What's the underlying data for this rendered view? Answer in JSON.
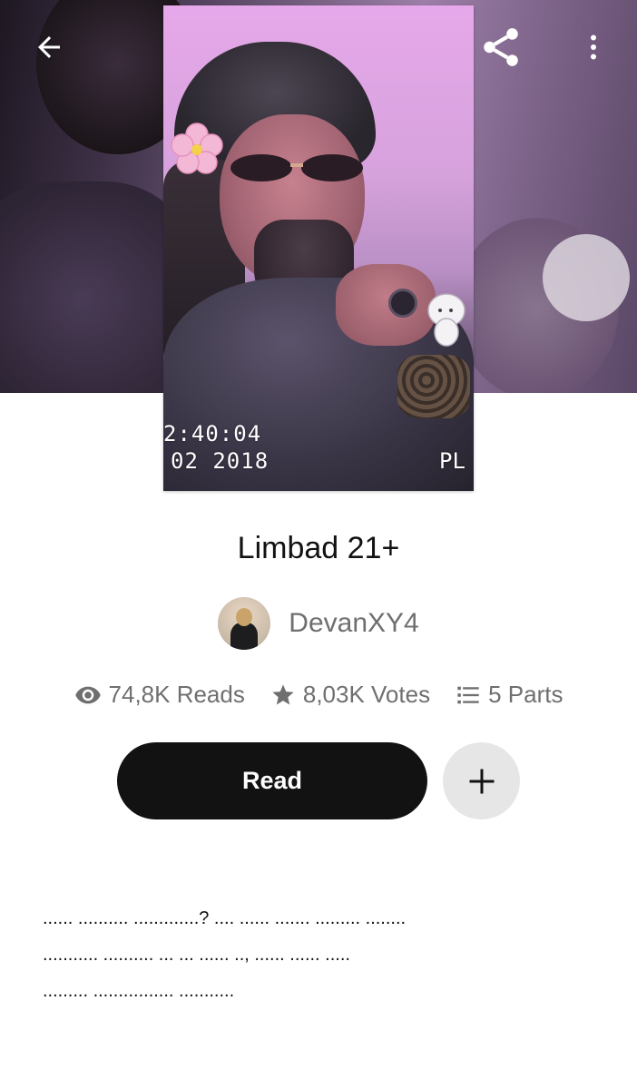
{
  "header": {
    "back_icon": "arrow-left-icon",
    "share_icon": "share-icon",
    "more_icon": "more-vertical-icon"
  },
  "cover": {
    "time_overlay": "2:40:04",
    "date_overlay": "02 2018",
    "play_overlay": "PL"
  },
  "story": {
    "title": "Limbad 21+",
    "author": "DevanXY4"
  },
  "stats": {
    "reads": "74,8K Reads",
    "votes": "8,03K Votes",
    "parts": "5 Parts",
    "reads_icon": "eye-icon",
    "votes_icon": "star-icon",
    "parts_icon": "list-icon"
  },
  "actions": {
    "read_label": "Read",
    "add_icon": "plus-icon"
  },
  "description": {
    "lines": [
      "...... .......... .............? .... ...... ....... ......... ........",
      "........... .......... ... ... ...... .., ...... ...... .....",
      "......... ................ ..........."
    ]
  },
  "colors": {
    "primary_button": "#121212",
    "secondary_button": "#e6e6e6",
    "muted_text": "#6f6f6f"
  }
}
